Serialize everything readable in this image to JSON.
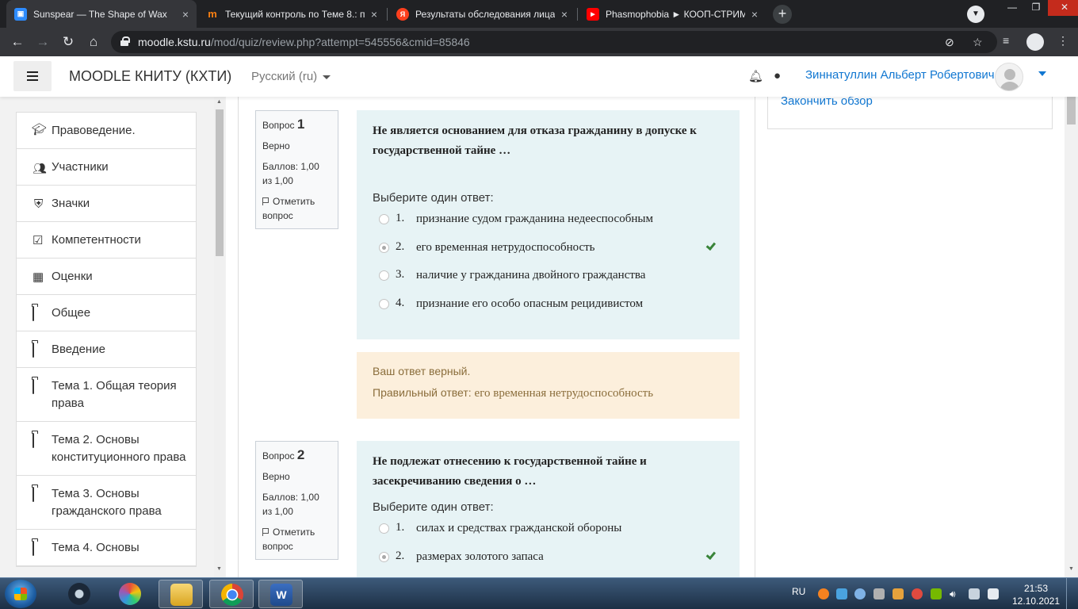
{
  "browser": {
    "tabs": [
      {
        "title": "Sunspear — The Shape of Wax",
        "favicon_color": "#2d8cff",
        "favicon_glyph": "💬",
        "active": false
      },
      {
        "title": "Текущий контроль по Теме 8.: п",
        "favicon_color": "#f98012",
        "favicon_glyph": "m",
        "active": true
      },
      {
        "title": "Результаты обследования лица,",
        "favicon_color": "#fc3f1d",
        "favicon_glyph": "Я",
        "active": false
      },
      {
        "title": "Phasmophobia ► КООП-СТРИМ",
        "favicon_color": "#ff0000",
        "favicon_glyph": "▶",
        "active": false
      }
    ],
    "tab_close": "×",
    "new_tab": "+",
    "url_host": "moodle.kstu.ru",
    "url_path": "/mod/quiz/review.php?attempt=545556&cmid=85846"
  },
  "navbar": {
    "brand": "MOODLE КНИТУ (КХТИ)",
    "language": "Русский (ru)",
    "user_name": "Зиннатуллин Альберт Робертович"
  },
  "drawer": {
    "items": [
      {
        "label": "Правоведение.",
        "icon": "graduation-cap-icon"
      },
      {
        "label": "Участники",
        "icon": "users-icon"
      },
      {
        "label": "Значки",
        "icon": "shield-icon"
      },
      {
        "label": "Компетентности",
        "icon": "checkbox-icon"
      },
      {
        "label": "Оценки",
        "icon": "table-icon"
      },
      {
        "label": "Общее",
        "icon": "folder-icon"
      },
      {
        "label": "Введение",
        "icon": "folder-icon"
      },
      {
        "label": "Тема 1. Общая теория права",
        "icon": "folder-icon"
      },
      {
        "label": "Тема 2. Основы конституционного права",
        "icon": "folder-icon"
      },
      {
        "label": "Тема 3. Основы гражданского права",
        "icon": "folder-icon"
      },
      {
        "label": "Тема 4. Основы",
        "icon": "folder-icon"
      }
    ]
  },
  "questions": [
    {
      "label": "Вопрос",
      "number": "1",
      "state": "Верно",
      "grade": "Баллов: 1,00 из 1,00",
      "flag": "Отметить вопрос",
      "text": "Не является основанием для отказа гражданину в допуске к государственной тайне …",
      "prompt": "Выберите один ответ:",
      "options": [
        {
          "num": "1.",
          "text": "признание судом гражданина недееспособным",
          "selected": false,
          "correct": false
        },
        {
          "num": "2.",
          "text": "его временная нетрудоспособность",
          "selected": true,
          "correct": true
        },
        {
          "num": "3.",
          "text": "наличие у гражданина двойного гражданства",
          "selected": false,
          "correct": false
        },
        {
          "num": "4.",
          "text": "признание его особо опасным рецидивистом",
          "selected": false,
          "correct": false
        }
      ],
      "feedback": "Ваш ответ верный.",
      "right_answer_label": "Правильный ответ:",
      "right_answer": "его временная нетрудоспособность"
    },
    {
      "label": "Вопрос",
      "number": "2",
      "state": "Верно",
      "grade": "Баллов: 1,00 из 1,00",
      "flag": "Отметить вопрос",
      "text": "Не подлежат отнесению к государственной тайне и засекречиванию сведения о …",
      "prompt": "Выберите один ответ:",
      "options": [
        {
          "num": "1.",
          "text": "силах и средствах гражданской обороны",
          "selected": false,
          "correct": false
        },
        {
          "num": "2.",
          "text": "размерах золотого запаса",
          "selected": true,
          "correct": true
        }
      ]
    }
  ],
  "sidebar_block": {
    "finish_review": "Закончить обзор"
  },
  "taskbar": {
    "lang": "RU",
    "time": "21:53",
    "date": "12.10.2021"
  },
  "colors": {
    "link": "#1177d1",
    "correct_tick": "#398439",
    "formulation_bg": "#e7f3f5",
    "outcome_bg": "#fcefdc"
  }
}
